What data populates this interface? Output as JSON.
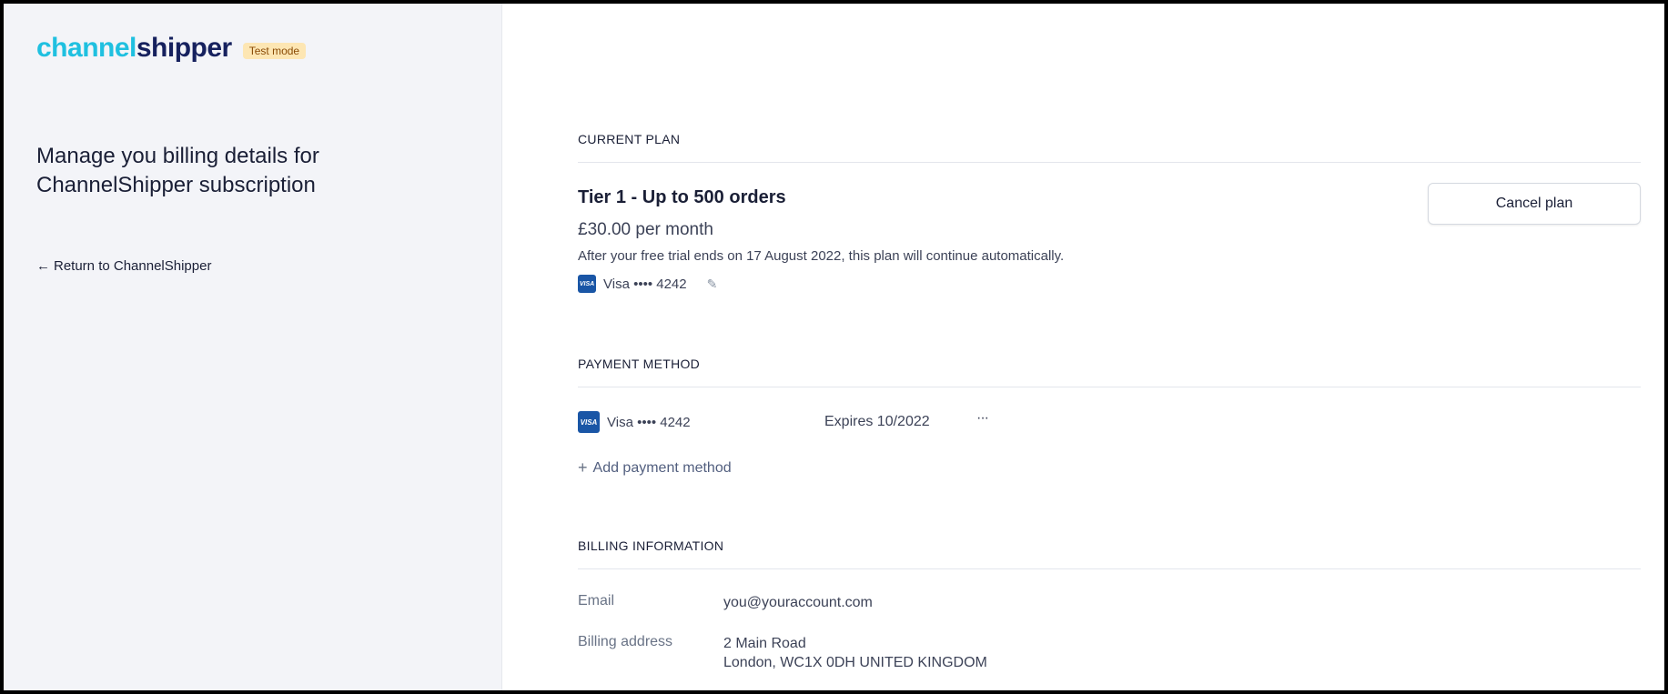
{
  "brand": {
    "logo_part1": "channel",
    "logo_part2": "shipper",
    "test_badge": "Test mode",
    "colors": {
      "cyan": "#1fc0e0",
      "navy": "#16215e"
    }
  },
  "sidebar": {
    "headline": "Manage you billing details for ChannelShipper subscription",
    "return_link": "Return to ChannelShipper"
  },
  "current_plan": {
    "section_title": "CURRENT PLAN",
    "plan_name": "Tier 1 - Up to 500 orders",
    "price": "£30.00 per month",
    "note": "After your free trial ends on 17 August 2022, this plan will continue automatically.",
    "card_brand_icon": "VISA",
    "card": "Visa •••• 4242",
    "cancel_label": "Cancel plan"
  },
  "payment_method": {
    "section_title": "PAYMENT METHOD",
    "card_brand_icon": "VISA",
    "card": "Visa •••• 4242",
    "expiry": "Expires 10/2022",
    "menu": "···",
    "add_label": "Add payment method"
  },
  "billing_info": {
    "section_title": "BILLING INFORMATION",
    "email_label": "Email",
    "email_value": "you@youraccount.com",
    "address_label": "Billing address",
    "address_line1": "2 Main Road",
    "address_line2": "London, WC1X 0DH UNITED KINGDOM"
  }
}
